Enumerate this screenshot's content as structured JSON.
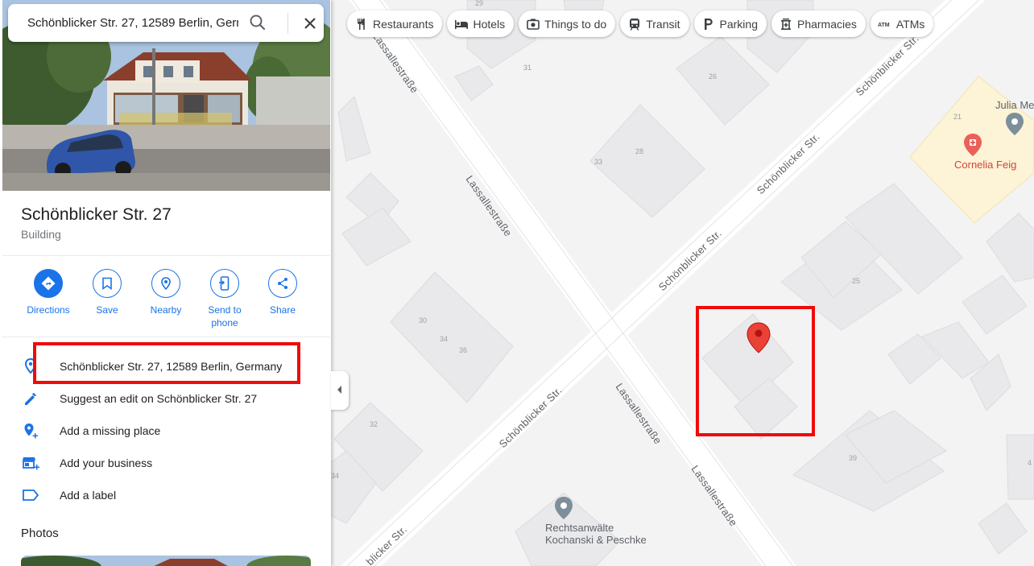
{
  "search": {
    "query": "Schönblicker Str. 27, 12589 Berlin, Germany"
  },
  "place": {
    "title": "Schönblicker Str. 27",
    "category": "Building"
  },
  "actions": [
    {
      "label": "Directions",
      "icon": "directions-icon"
    },
    {
      "label": "Save",
      "icon": "bookmark-icon"
    },
    {
      "label": "Nearby",
      "icon": "nearby-icon"
    },
    {
      "label": "Send to phone",
      "icon": "send-to-phone-icon"
    },
    {
      "label": "Share",
      "icon": "share-icon"
    }
  ],
  "info_rows": [
    {
      "text": "Schönblicker Str. 27, 12589 Berlin, Germany",
      "icon": "location-pin-icon"
    },
    {
      "text": "Suggest an edit on Schönblicker Str. 27",
      "icon": "pencil-icon"
    },
    {
      "text": "Add a missing place",
      "icon": "add-place-icon"
    },
    {
      "text": "Add your business",
      "icon": "add-business-icon"
    },
    {
      "text": "Add a label",
      "icon": "label-icon"
    }
  ],
  "photos_heading": "Photos",
  "chips": [
    {
      "label": "Restaurants",
      "icon": "fork-knife-icon"
    },
    {
      "label": "Hotels",
      "icon": "bed-icon"
    },
    {
      "label": "Things to do",
      "icon": "camera-icon"
    },
    {
      "label": "Transit",
      "icon": "train-icon"
    },
    {
      "label": "Parking",
      "icon": "parking-icon"
    },
    {
      "label": "Pharmacies",
      "icon": "pharmacy-icon"
    },
    {
      "label": "ATMs",
      "icon": "atm-icon"
    }
  ],
  "map": {
    "roads": {
      "lassalle": "Lassallestraße",
      "schoenblicker": "Schönblicker Str.",
      "schoenblicker_trunc": "blicker Str."
    },
    "building_numbers": [
      "29",
      "31",
      "26",
      "28",
      "33",
      "21",
      "25",
      "30",
      "34",
      "36",
      "32",
      "39",
      "34",
      "4"
    ],
    "pois": [
      {
        "name": "Julia Me",
        "type": "gray-pin"
      },
      {
        "name": "Cornelia Feig",
        "type": "pharmacy-pin"
      },
      {
        "name": "Rechtsanwälte",
        "name2": "Kochanski & Peschke",
        "type": "gray-pin"
      }
    ],
    "colors": {
      "road": "#ffffff",
      "building": "#e8e8ea",
      "park": "#fcf3d8",
      "pin": "#ea4335",
      "accent": "#1a73e8"
    }
  }
}
